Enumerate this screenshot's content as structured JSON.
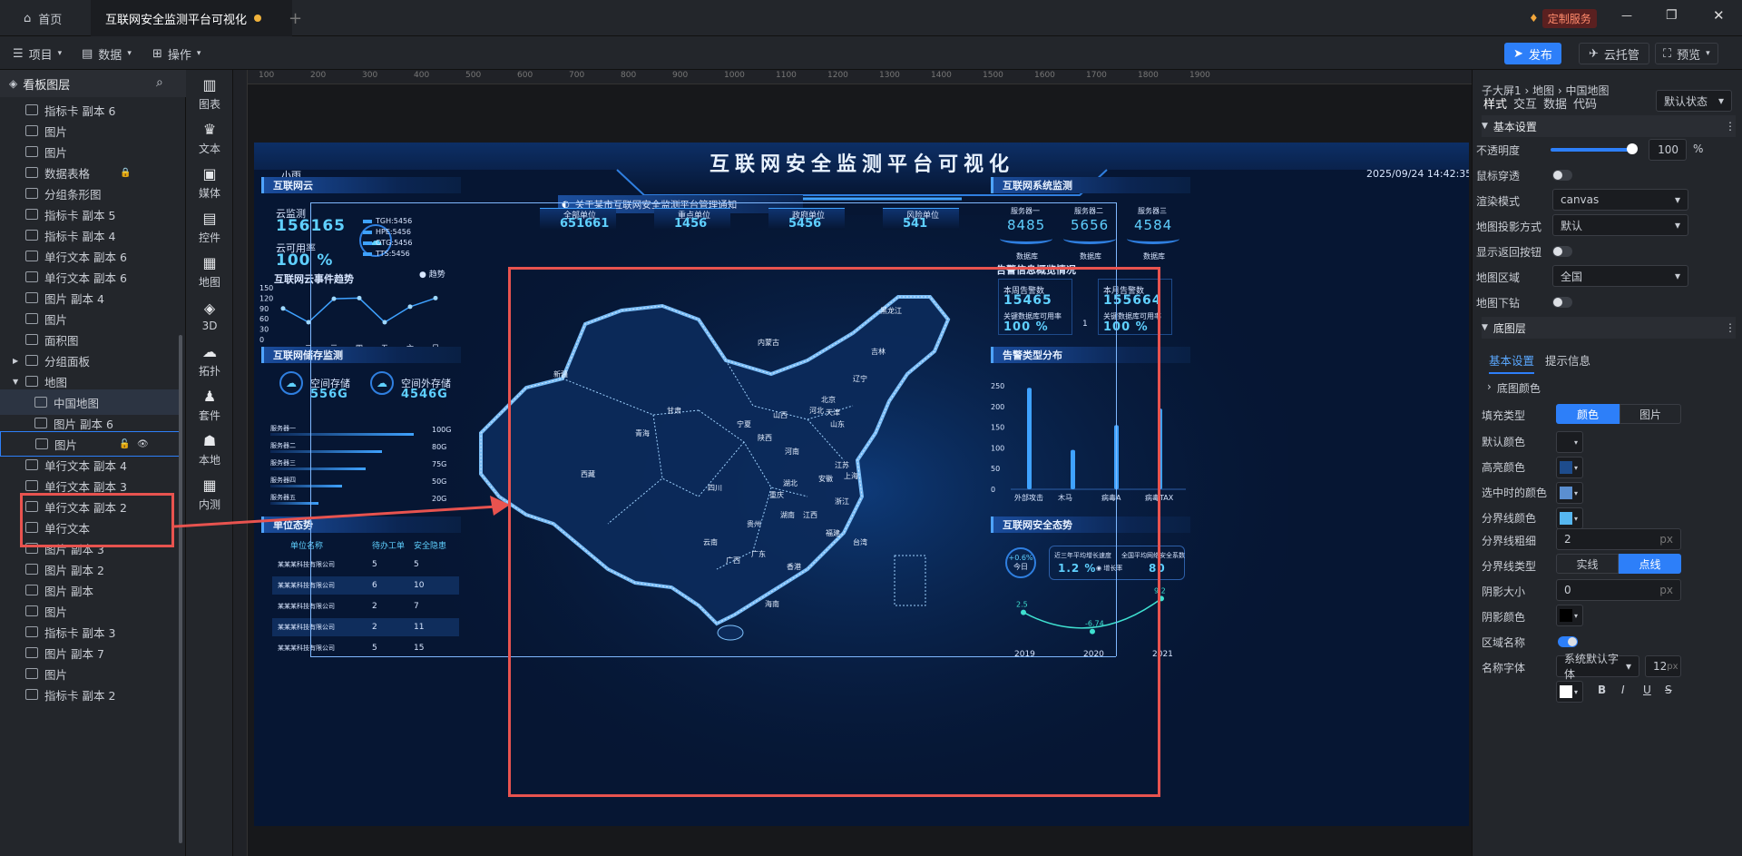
{
  "titlebar": {
    "home_tab": "首页",
    "doc_tab": "互联网安全监测平台可视化",
    "custom_service": "定制服务"
  },
  "toolbar": {
    "project": "项目",
    "data": "数据",
    "operate": "操作",
    "publish": "发布",
    "cloud": "云托管",
    "preview": "预览"
  },
  "left_panel": {
    "title": "看板图层",
    "layers": [
      {
        "label": "指标卡 副本 6",
        "icon": "indicator-card-icon",
        "indent": 1
      },
      {
        "label": "图片",
        "icon": "image-icon",
        "indent": 1
      },
      {
        "label": "图片",
        "icon": "image-icon",
        "indent": 1
      },
      {
        "label": "数据表格",
        "icon": "table-icon",
        "indent": 1,
        "locked": true
      },
      {
        "label": "分组条形图",
        "icon": "bar-chart-icon",
        "indent": 1
      },
      {
        "label": "指标卡 副本 5",
        "icon": "indicator-card-icon",
        "indent": 1
      },
      {
        "label": "指标卡 副本 4",
        "icon": "indicator-card-icon",
        "indent": 1
      },
      {
        "label": "单行文本 副本 6",
        "icon": "text-icon",
        "indent": 1
      },
      {
        "label": "单行文本 副本 6",
        "icon": "text-icon",
        "indent": 1
      },
      {
        "label": "图片 副本 4",
        "icon": "image-icon",
        "indent": 1
      },
      {
        "label": "图片",
        "icon": "image-icon",
        "indent": 1
      },
      {
        "label": "面积图",
        "icon": "area-chart-icon",
        "indent": 1
      },
      {
        "label": "分组面板",
        "icon": "group-icon",
        "indent": 1,
        "caret": "right"
      },
      {
        "label": "地图",
        "icon": "folder-icon",
        "indent": 1,
        "caret": "down"
      },
      {
        "label": "中国地图",
        "icon": "map-icon",
        "indent": 2,
        "active": true
      },
      {
        "label": "图片 副本 6",
        "icon": "image-icon",
        "indent": 2
      },
      {
        "label": "图片",
        "icon": "image-icon",
        "indent": 2,
        "selected": true
      },
      {
        "label": "单行文本 副本 4",
        "icon": "text-icon",
        "indent": 1
      },
      {
        "label": "单行文本 副本 3",
        "icon": "text-icon",
        "indent": 1
      },
      {
        "label": "单行文本 副本 2",
        "icon": "text-icon",
        "indent": 1
      },
      {
        "label": "单行文本",
        "icon": "text-icon",
        "indent": 1
      },
      {
        "label": "图片 副本 3",
        "icon": "image-icon",
        "indent": 1
      },
      {
        "label": "图片 副本 2",
        "icon": "image-icon",
        "indent": 1
      },
      {
        "label": "图片 副本",
        "icon": "image-icon",
        "indent": 1
      },
      {
        "label": "图片",
        "icon": "image-icon",
        "indent": 1
      },
      {
        "label": "指标卡 副本 3",
        "icon": "indicator-card-icon",
        "indent": 1
      },
      {
        "label": "图片 副本 7",
        "icon": "image-icon",
        "indent": 1
      },
      {
        "label": "图片",
        "icon": "image-icon",
        "indent": 1
      },
      {
        "label": "指标卡 副本 2",
        "icon": "indicator-card-icon",
        "indent": 1
      }
    ]
  },
  "icon_bar": [
    "图表",
    "文本",
    "媒体",
    "控件",
    "地图",
    "3D",
    "拓扑",
    "套件",
    "本地",
    "内测"
  ],
  "ruler": {
    "ticks": [
      "100",
      "200",
      "300",
      "400",
      "500",
      "600",
      "700",
      "800",
      "900",
      "1000",
      "1100",
      "1200",
      "1300",
      "1400",
      "1500",
      "1600",
      "1700",
      "1800",
      "1900"
    ]
  },
  "dashboard": {
    "title": "互联网安全监测平台可视化",
    "weather": "小雨",
    "datetime": "2025/09/24 14:42:35",
    "notice": "关于某市互联网安全监测平台管理通知",
    "cloud_panel": {
      "title": "互联网云",
      "cloud_label": "云监测",
      "cloud_value": "156165",
      "rate_label": "云可用率",
      "rate_value": "100 %",
      "legend": [
        "TGH:5456",
        "HPE:5456",
        "OTG:5456",
        "TTS:5456"
      ]
    },
    "trend": {
      "title": "互联网云事件趋势",
      "legend": "趋势"
    },
    "storage_panel": {
      "title": "互联网储存监测",
      "in_label": "空间存储",
      "in_value": "556G",
      "out_label": "空间外存储",
      "out_value": "4546G",
      "servers": [
        "服务器一",
        "服务器二",
        "服务器三",
        "服务器四",
        "服务器五"
      ],
      "capacities": [
        "100G",
        "80G",
        "75G",
        "50G",
        "20G"
      ],
      "fill": [
        0.9,
        0.7,
        0.6,
        0.45,
        0.3
      ]
    },
    "units_panel": {
      "title": "单位态势",
      "headers": [
        "单位名称",
        "待办工单",
        "安全隐患"
      ],
      "rows": [
        [
          "某某某科技有限公司",
          "5",
          "5"
        ],
        [
          "某某某科技有限公司",
          "6",
          "10"
        ],
        [
          "某某某科技有限公司",
          "2",
          "7"
        ],
        [
          "某某某科技有限公司",
          "2",
          "11"
        ],
        [
          "某某某科技有限公司",
          "5",
          "15"
        ]
      ]
    },
    "top_stats": [
      {
        "label": "全部单位",
        "value": "651661"
      },
      {
        "label": "重点单位",
        "value": "1456"
      },
      {
        "label": "政府单位",
        "value": "5456"
      },
      {
        "label": "风险单位",
        "value": "541"
      }
    ],
    "provinces": [
      "新疆",
      "西藏",
      "青海",
      "甘肃",
      "内蒙古",
      "黑龙江",
      "吉林",
      "辽宁",
      "北京",
      "天津",
      "河北",
      "山西",
      "陕西",
      "宁夏",
      "河南",
      "山东",
      "江苏",
      "安徽",
      "上海",
      "湖北",
      "四川",
      "重庆",
      "贵州",
      "云南",
      "湖南",
      "江西",
      "浙江",
      "福建",
      "广东",
      "广西",
      "台湾",
      "海南",
      "香港"
    ],
    "system_panel": {
      "title": "互联网系统监测",
      "servers": [
        {
          "label": "服务器一",
          "value": "8485",
          "sub": "数据库"
        },
        {
          "label": "服务器二",
          "value": "5656",
          "sub": "数据库"
        },
        {
          "label": "服务器三",
          "value": "4584",
          "sub": "数据库"
        }
      ]
    },
    "alert_panel": {
      "title": "告警信息概览情况",
      "week_label": "本周告警数",
      "week_value": "15465",
      "week_rate_label": "关键数据库可用率",
      "week_rate": "100 %",
      "month_label": "本月告警数",
      "month_value": "155664",
      "month_rate_label": "关键数据库可用率",
      "month_rate": "100 %",
      "sep": "1"
    },
    "warn_type": {
      "title": "告警类型分布"
    },
    "security_panel": {
      "title": "互联网安全态势",
      "badge": "+0.6%",
      "badge_sub": "今日",
      "growth_label": "近三年平均增长速度",
      "growth_value": "1.2 %",
      "growth_legend": "增长率",
      "index_label": "全国平均网络安全系数",
      "index_value": "80"
    }
  },
  "chart_data": [
    {
      "type": "line",
      "title": "互联网云事件趋势",
      "categories": [
        "一",
        "二",
        "三",
        "四",
        "五",
        "六",
        "日"
      ],
      "series": [
        {
          "name": "趋势",
          "values": [
            90,
            50,
            118,
            120,
            50,
            95,
            120
          ]
        }
      ],
      "ylim": [
        0,
        150
      ],
      "yticks": [
        "150",
        "120",
        "90",
        "60",
        "30",
        "0"
      ]
    },
    {
      "type": "bar",
      "title": "告警类型分布",
      "categories": [
        "外部攻击",
        "木马",
        "病毒A",
        "病毒TAX"
      ],
      "values": [
        245,
        95,
        155,
        195
      ],
      "ylim": [
        0,
        250
      ],
      "yticks": [
        "250",
        "200",
        "150",
        "100",
        "50",
        "0"
      ]
    },
    {
      "type": "line",
      "title": "互联网安全态势",
      "categories": [
        "2019",
        "2020",
        "2021"
      ],
      "values": [
        2.5,
        -6.74,
        9.2
      ],
      "labels": [
        "2.5",
        "-6.74",
        "9.2"
      ]
    }
  ],
  "right_panel": {
    "breadcrumb": "子大屏1 › 地图 › 中国地图",
    "tabs": [
      "样式",
      "交互",
      "数据",
      "代码"
    ],
    "state": "默认状态",
    "basic_section": "基本设置",
    "opacity_label": "不透明度",
    "opacity_value": "100",
    "mouse_label": "鼠标穿透",
    "render_label": "渲染模式",
    "render_value": "canvas",
    "projection_label": "地图投影方式",
    "projection_value": "默认",
    "back_label": "显示返回按钮",
    "region_label": "地图区域",
    "region_value": "全国",
    "drill_label": "地图下钻",
    "base_section": "底图层",
    "sub_tabs": [
      "基本设置",
      "提示信息"
    ],
    "base_color": "底图颜色",
    "fill_label": "填充类型",
    "fill_color": "颜色",
    "fill_image": "图片",
    "default_color_label": "默认颜色",
    "highlight_label": "高亮颜色",
    "selected_label": "选中时的颜色",
    "border_color_label": "分界线颜色",
    "border_width_label": "分界线粗细",
    "border_width_value": "2",
    "border_type_label": "分界线类型",
    "border_solid": "实线",
    "border_dotted": "点线",
    "shadow_size_label": "阴影大小",
    "shadow_size_value": "0",
    "shadow_color_label": "阴影颜色",
    "region_name_label": "区域名称",
    "font_label": "名称字体",
    "font_value": "系统默认字体",
    "font_size": "12",
    "px": "px",
    "percent": "%"
  },
  "colors": {
    "accent": "#2d7ff9",
    "highlight": "#1e4c8c",
    "selected": "#5b8fd0",
    "border": "#56b7f0",
    "shadow": "#000000",
    "annotation": "#e8534f"
  }
}
